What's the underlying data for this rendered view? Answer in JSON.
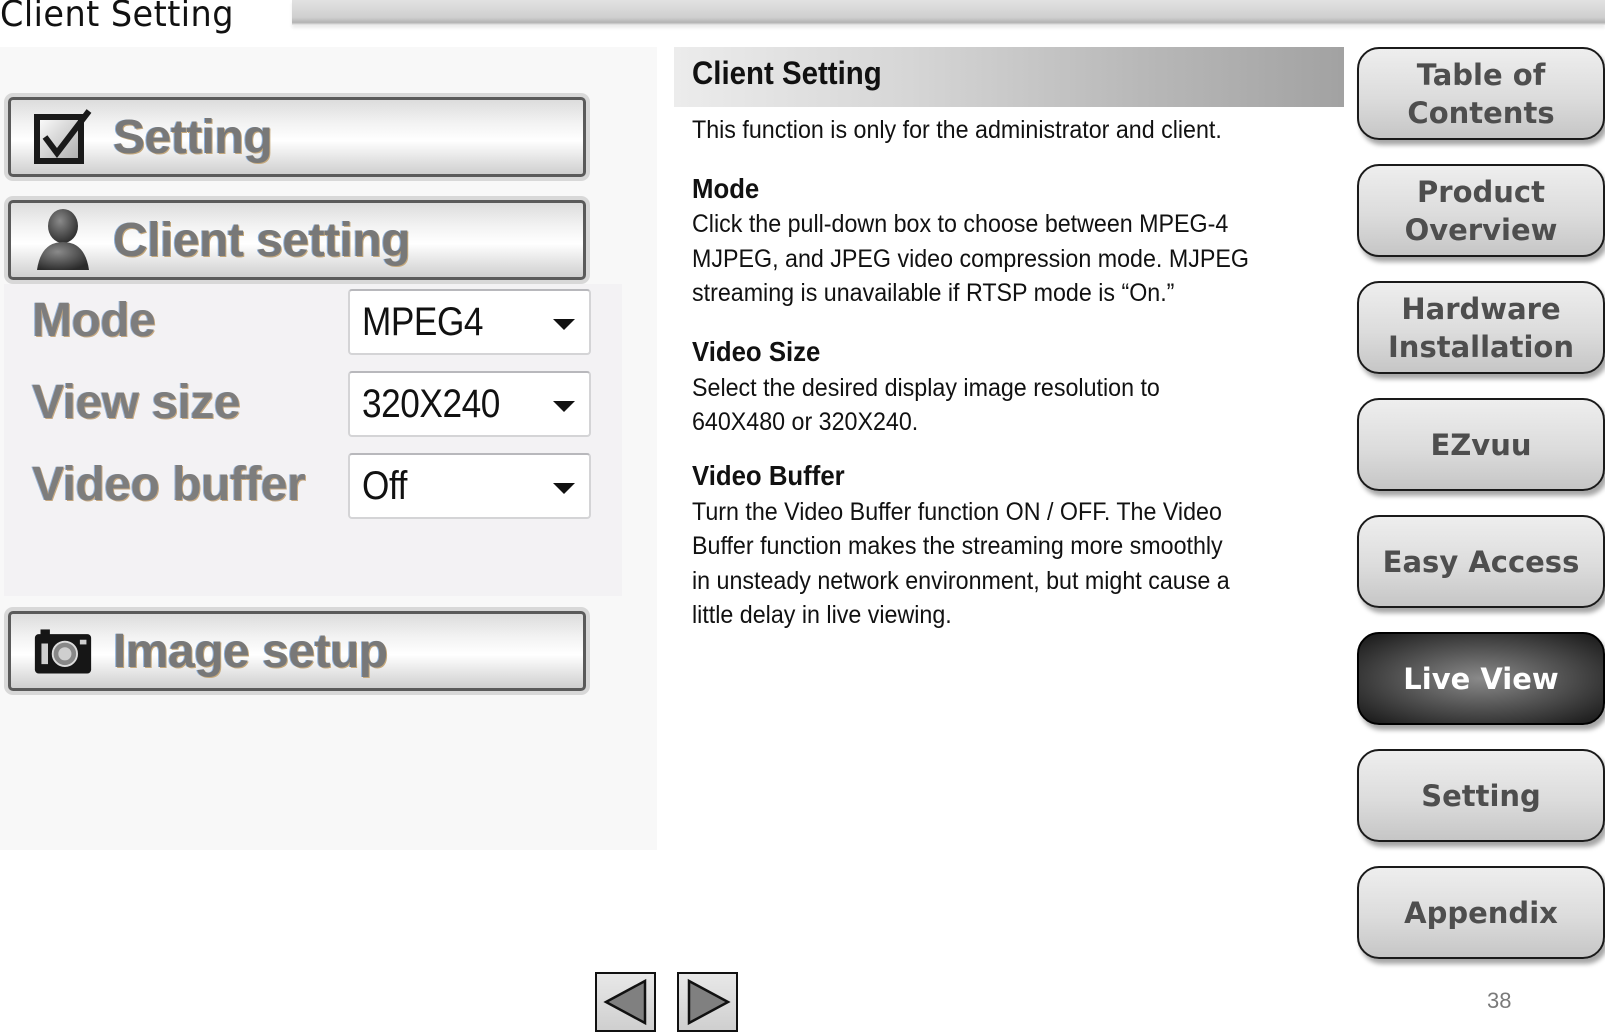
{
  "page": {
    "title": "Client Setting",
    "page_number": "38"
  },
  "screenshot_panel": {
    "menu_buttons": [
      {
        "label": "Setting",
        "icon": "checkbox-icon"
      },
      {
        "label": "Client setting",
        "icon": "user-icon"
      },
      {
        "label": "Image setup",
        "icon": "camera-icon"
      }
    ],
    "form": [
      {
        "label": "Mode",
        "value": "MPEG4"
      },
      {
        "label": "View size",
        "value": "320X240"
      },
      {
        "label": "Video buffer",
        "value": "Off"
      }
    ]
  },
  "content": {
    "header": "Client Setting",
    "intro": "This function is only for the administrator and client.",
    "sections": [
      {
        "title": "Mode",
        "lines": [
          "Click the pull-down box to choose between MPEG-4",
          "MJPEG, and JPEG video compression mode. MJPEG",
          "streaming is unavailable if RTSP mode is “On.”"
        ]
      },
      {
        "title": "Video Size",
        "lines": [
          "Select the desired display image resolution to",
          "640X480 or 320X240."
        ]
      },
      {
        "title": "Video Buffer",
        "lines": [
          "Turn the Video Buffer function ON / OFF. The Video",
          "Buffer function makes the streaming more smoothly",
          "in unsteady network environment, but might cause a",
          "little delay in live viewing."
        ]
      }
    ]
  },
  "navigation": {
    "items": [
      {
        "label": "Table of\nContents",
        "active": false
      },
      {
        "label": "Product\nOverview",
        "active": false
      },
      {
        "label": "Hardware\nInstallation",
        "active": false
      },
      {
        "label": "EZvuu",
        "active": false
      },
      {
        "label": "Easy Access",
        "active": false
      },
      {
        "label": "Live View",
        "active": true
      },
      {
        "label": "Setting",
        "active": false
      },
      {
        "label": "Appendix",
        "active": false
      }
    ],
    "prev_icon": "triangle-left-icon",
    "next_icon": "triangle-right-icon"
  },
  "colors": {
    "active_nav_text": "#ffffff",
    "nav_text": "#4e4e4e",
    "arrow_fill": "#808080"
  }
}
